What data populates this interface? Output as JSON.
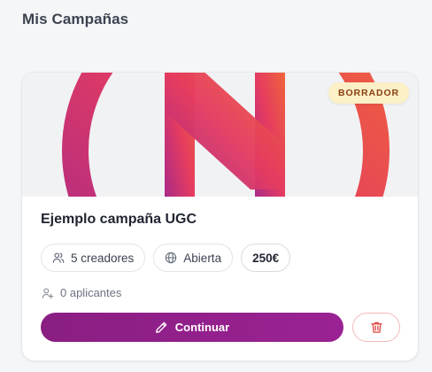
{
  "page": {
    "title": "Mis Campañas"
  },
  "campaign": {
    "status": "BORRADOR",
    "title": "Ejemplo campaña UGC",
    "creators": "5 creadores",
    "visibility": "Abierta",
    "price": "250€",
    "applicants": "0 aplicantes",
    "continue_label": "Continuar",
    "cover_logo": "gradient-h-circle-logo"
  },
  "icons": {
    "creators": "users-icon",
    "visibility": "globe-icon",
    "applicants": "user-plus-icon",
    "continue": "pencil-icon",
    "delete": "trash-icon"
  },
  "colors": {
    "primary": "#8a1e82",
    "badge_bg": "#fbf0c6",
    "badge_text": "#8a3e12",
    "delete": "#e0453f",
    "logo_gradient_start": "#f0512f",
    "logo_gradient_end": "#a62184"
  }
}
